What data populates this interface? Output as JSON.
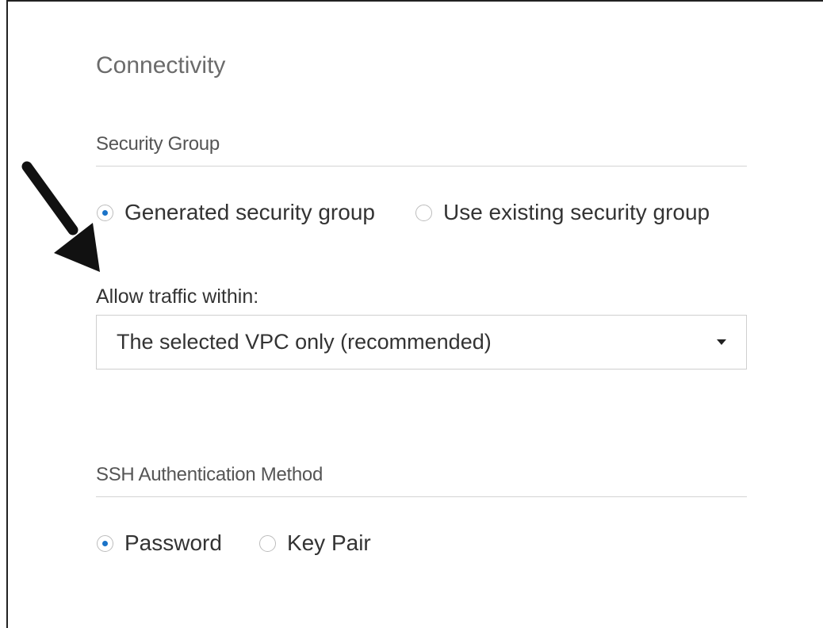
{
  "panel": {
    "title": "Connectivity"
  },
  "security_group": {
    "title": "Security Group",
    "options": [
      {
        "label": "Generated security group",
        "selected": true
      },
      {
        "label": "Use existing security group",
        "selected": false
      }
    ],
    "allow_traffic": {
      "label": "Allow traffic within:",
      "value": "The selected VPC only (recommended)",
      "icon": "caret-down-icon"
    }
  },
  "ssh": {
    "title": "SSH Authentication Method",
    "options": [
      {
        "label": "Password",
        "selected": true
      },
      {
        "label": "Key Pair",
        "selected": false
      }
    ]
  },
  "annotation": {
    "icon": "arrow-pointer-icon",
    "color": "#111111"
  },
  "colors": {
    "accent": "#1a73c8",
    "frame_border": "#222222",
    "divider": "#d4d4d4"
  }
}
